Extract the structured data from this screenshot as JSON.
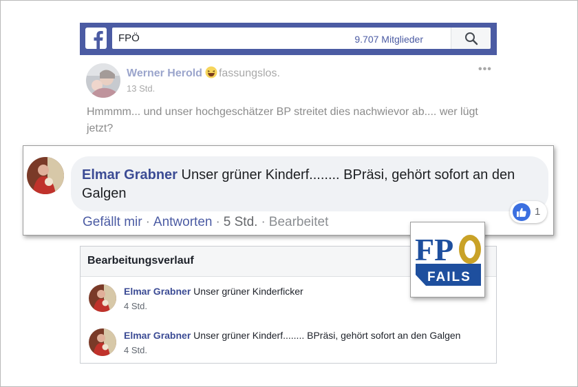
{
  "colors": {
    "facebook_blue": "#4b5ba3",
    "name_link": "#3b4b94",
    "bubble_bg": "#f0f2f5",
    "fpo_blue": "#1e4f9e",
    "fpo_gold": "#c9a227"
  },
  "top_bar": {
    "logo_icon": "facebook-f-icon",
    "search_value": "FPÖ",
    "members_label": "9.707 Mitglieder",
    "search_icon": "magnifier-icon"
  },
  "post": {
    "author": "Werner Herold",
    "feeling_icon": "laughing-emoji-icon",
    "feeling": "fassungslos.",
    "time": "13 Std.",
    "menu": "•••",
    "body": "Hmmmm... und unser hochgeschätzer BP streitet dies nachwievor ab.... wer lügt jetzt?"
  },
  "comment": {
    "author": "Elmar Grabner",
    "text": "Unser grüner Kinderf........ BPräsi, gehört sofort an den Galgen",
    "reaction_icon": "like-thumb-icon",
    "reaction_count": "1",
    "actions": {
      "like": "Gefällt mir",
      "reply": "Antworten",
      "time": "5 Std.",
      "edited": "Bearbeitet",
      "separator": "·"
    }
  },
  "history": {
    "title": "Bearbeitungsverlauf",
    "items": [
      {
        "author": "Elmar Grabner",
        "text": "Unser grüner Kinderficker",
        "time": "4 Std."
      },
      {
        "author": "Elmar Grabner",
        "text": "Unser grüner Kinderf........ BPräsi, gehört sofort an den Galgen",
        "time": "4 Std."
      }
    ]
  },
  "watermark": {
    "line1": "FPÖ",
    "line2": "FAILS"
  }
}
